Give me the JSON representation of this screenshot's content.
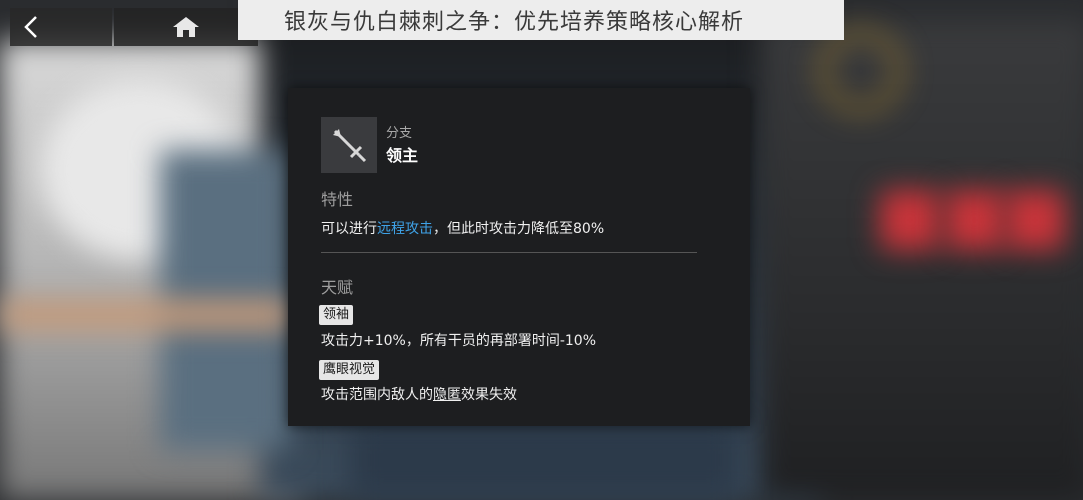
{
  "page_title": "银灰与仇白棘刺之争：优先培养策略核心解析",
  "nav": {
    "back_icon": "chevron-left-icon",
    "home_icon": "home-icon"
  },
  "branch": {
    "icon": "sword-icon",
    "caption": "分支",
    "name": "领主"
  },
  "trait": {
    "title": "特性",
    "text_before": "可以进行",
    "text_highlight": "远程攻击",
    "text_after": "，但此时攻击力降低至80%",
    "highlight_color": "#3fa3e8"
  },
  "talents": {
    "title": "天赋",
    "items": [
      {
        "name": "领袖",
        "desc": "攻击力+10%，所有干员的再部署时间-10%"
      },
      {
        "name": "鹰眼视觉",
        "desc_before": "攻击范围内敌人的",
        "desc_underlined": "隐匿",
        "desc_after": "效果失效"
      }
    ]
  }
}
